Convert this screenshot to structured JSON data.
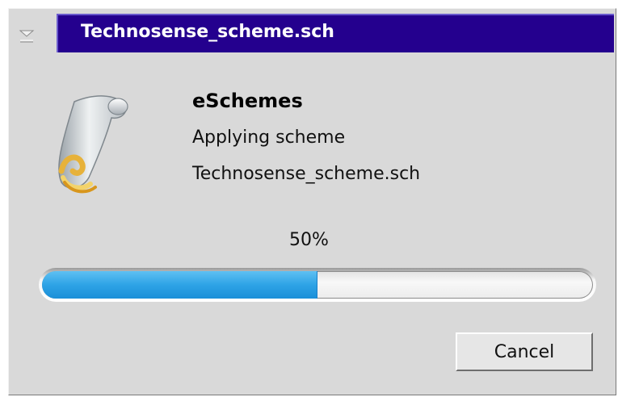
{
  "window": {
    "title": "Technosense_scheme.sch",
    "titlebar_color": "#24008e"
  },
  "icons": {
    "window_menu": "window-menu-icon",
    "app": "paper-scroll-icon"
  },
  "dialog": {
    "app_name": "eSchemes",
    "status": "Applying scheme",
    "file": "Technosense_scheme.sch"
  },
  "progress": {
    "label": "50%",
    "value": 0.5,
    "fill_color": "#2ea3e6"
  },
  "buttons": {
    "cancel": "Cancel"
  }
}
